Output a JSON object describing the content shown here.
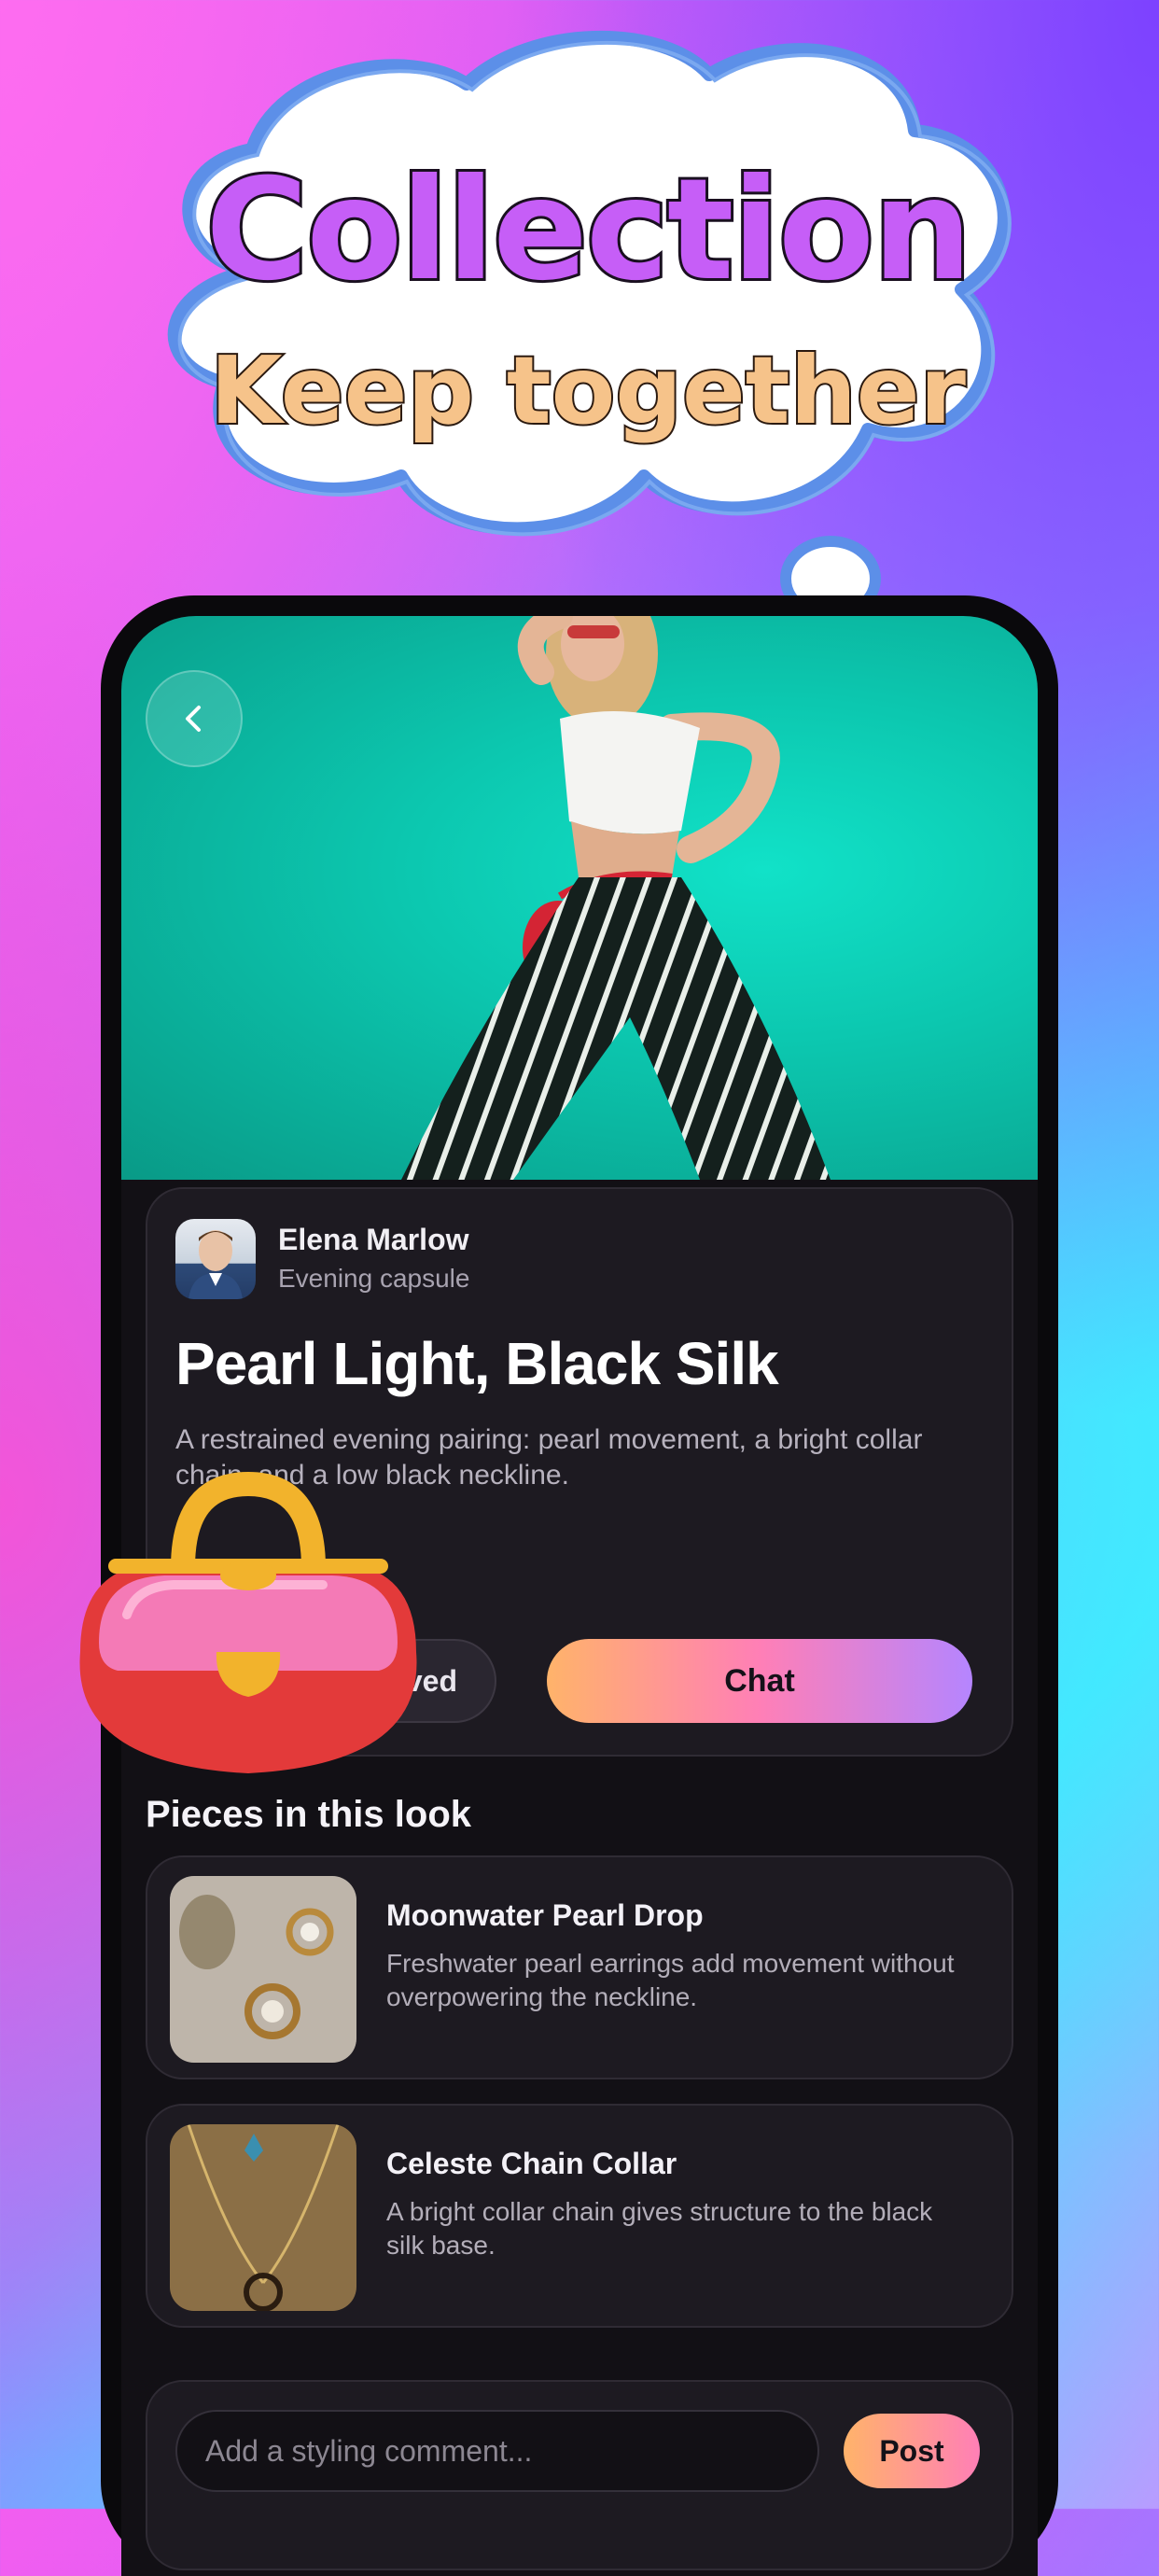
{
  "promo": {
    "title": "Collection",
    "subtitle": "Keep together"
  },
  "header": {
    "back_icon": "chevron-left-icon"
  },
  "look": {
    "author_name": "Elena Marlow",
    "author_subtitle": "Evening capsule",
    "title": "Pearl Light, Black Silk",
    "description": "A restrained evening pairing: pearl movement, a bright collar chain, and a low black neckline.",
    "saved_label": "Saved",
    "chat_label": "Chat"
  },
  "pieces_section": {
    "title": "Pieces in this look",
    "items": [
      {
        "name": "Moonwater Pearl Drop",
        "description": "Freshwater pearl earrings add movement without overpowering the neckline."
      },
      {
        "name": "Celeste Chain Collar",
        "description": "A bright collar chain gives structure to the black silk base."
      }
    ]
  },
  "comment": {
    "placeholder": "Add a styling comment...",
    "post_label": "Post"
  },
  "colors": {
    "accent_start": "#ffb36a",
    "accent_mid": "#ff7fb6",
    "accent_end": "#b585ff",
    "card_bg": "#1d1a21",
    "hero_bg": "#0cc7af"
  }
}
